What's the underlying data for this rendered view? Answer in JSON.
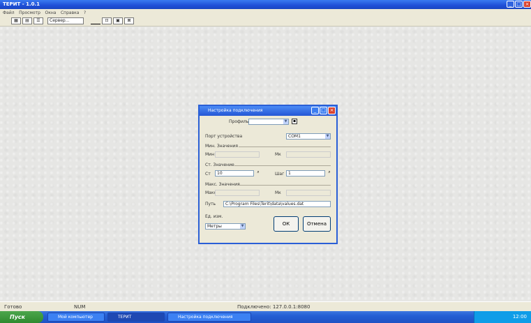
{
  "window": {
    "title": "ТЕРИТ - 1.0.1"
  },
  "menubar": {
    "items": [
      "Файл",
      "Просмотр",
      "Окна",
      "Справка",
      "?"
    ]
  },
  "toolbar": {
    "combo_value": "Сервер..."
  },
  "dialog": {
    "title": "Настройка подключения",
    "preset_label": "Профиль:",
    "preset_value": "",
    "line1_label": "Порт устройства",
    "line1_value": "COM1",
    "group1_label": "Мин. Значения",
    "g1_left_label": "Мин",
    "g1_right_label": "Мк",
    "group2_label": "Ст. Значение",
    "g2_left_label": "Ст",
    "g2_left_value": "10",
    "g2_right_label": "Шаг",
    "g2_right_value": "1",
    "group3_label": "Макс. Значения",
    "g3_left_label": "Макс",
    "g3_right_label": "Мк",
    "path_label": "Путь",
    "path_value": "C:\\Program Files\\Terit\\data\\values.dat",
    "unit_label": "Ед. изм.",
    "unit_value": "Метры",
    "ok_label": "ОК",
    "cancel_label": "Отмена"
  },
  "statusbar": {
    "left": "Готово",
    "mid": "NUM",
    "center": "Подключено: 127.0.0.1:8080"
  },
  "taskbar": {
    "start_label": "Пуск",
    "tasks": [
      "Мой компьютер",
      "ТЕРИТ",
      "Настройка подключения"
    ],
    "clock": "12:00"
  }
}
